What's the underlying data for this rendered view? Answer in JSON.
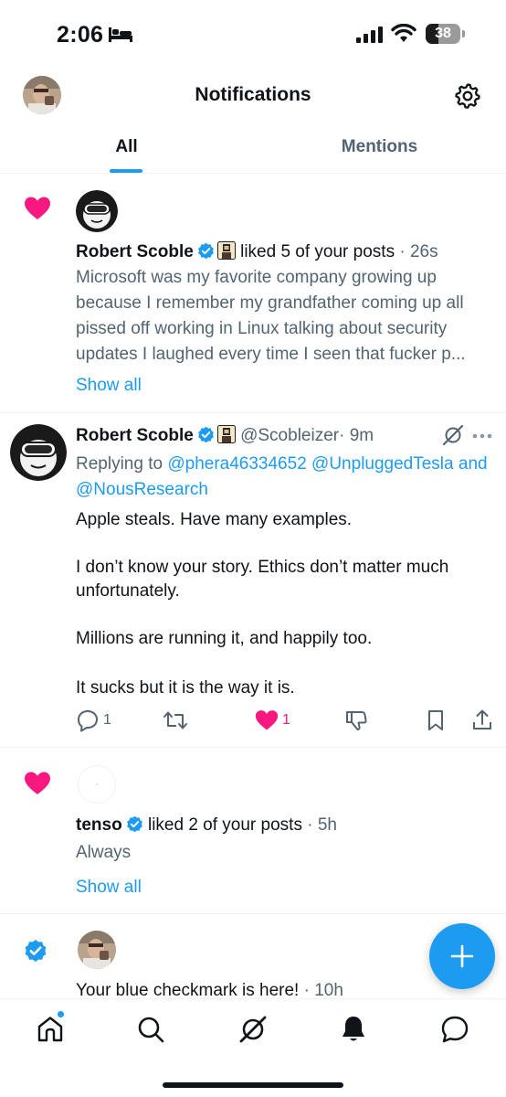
{
  "status_bar": {
    "time": "2:06",
    "battery": "38",
    "battery_level": 0.38
  },
  "header": {
    "title": "Notifications",
    "avatar_icon": "user-avatar",
    "settings_icon": "gear-icon"
  },
  "tabs": [
    {
      "label": "All",
      "selected": true
    },
    {
      "label": "Mentions",
      "selected": false
    }
  ],
  "notifications": [
    {
      "type": "like",
      "name": "Robert Scoble",
      "action_text": "liked 5 of your posts",
      "time": "· 26s",
      "preview": "Microsoft was my favorite company growing up because I remember my grandfather coming up all pissed off working in Linux talking about security updates I laughed every time I seen that fucker p...",
      "show_all": "Show all"
    },
    {
      "type": "reply",
      "name": "Robert Scoble",
      "handle": "@Scobleizer",
      "time": "· 9m",
      "replying_to_label": "Replying to",
      "mention_1": "@phera46334652",
      "mention_2": "@UnpluggedTesla",
      "mention_and": "and",
      "mention_3": "@NousResearch",
      "body": [
        "Apple steals. Have many examples.",
        "I don’t know your story. Ethics don’t matter much unfortunately.",
        "Millions are running it, and happily too.",
        "It sucks but it is the way it is."
      ],
      "actions": {
        "replies": "1",
        "reposts": "",
        "likes": "1"
      }
    },
    {
      "type": "like",
      "name": "tenso",
      "action_text": "liked 2 of your posts",
      "time": "· 5h",
      "preview": "Always",
      "show_all": "Show all"
    },
    {
      "type": "verified",
      "text": "Your blue checkmark is here!",
      "time": "· 10h"
    }
  ],
  "bottom_nav": [
    "home-icon",
    "search-icon",
    "grok-icon",
    "bell-icon",
    "messages-icon"
  ],
  "colors": {
    "accent": "#1d9bf0",
    "like": "#f91880",
    "text": "#0f1419",
    "muted": "#536471"
  }
}
